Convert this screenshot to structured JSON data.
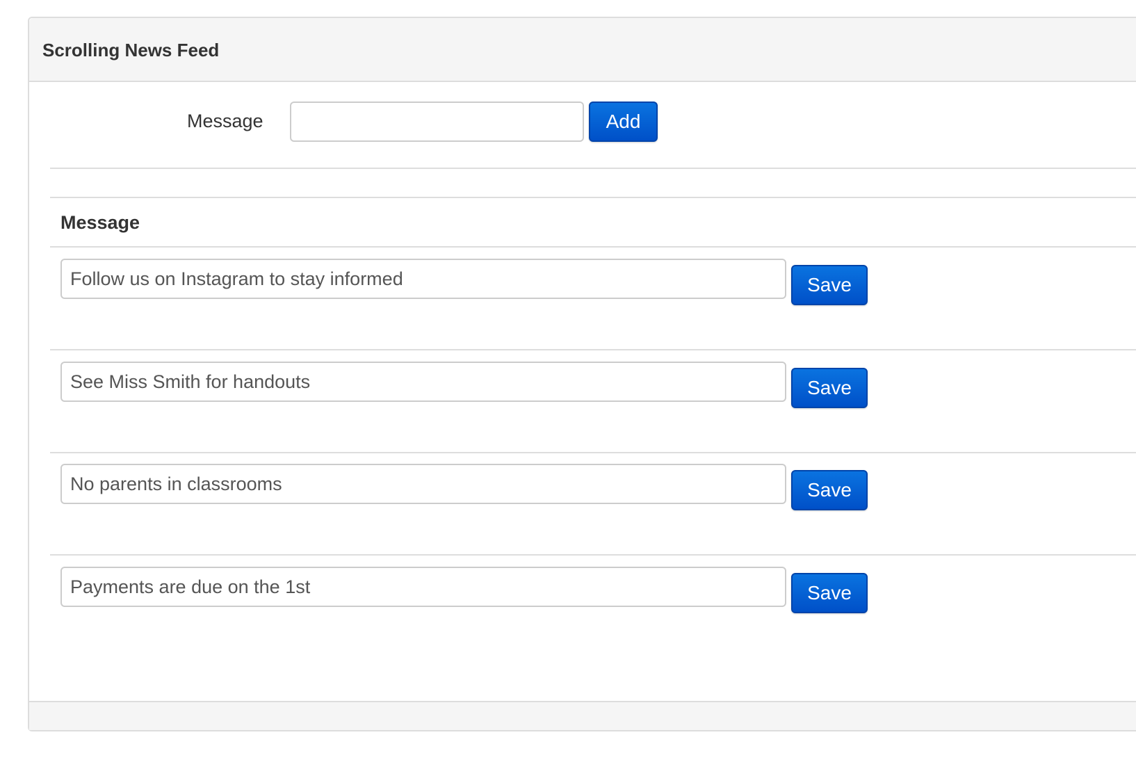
{
  "panel": {
    "title": "Scrolling News Feed"
  },
  "add_form": {
    "label": "Message",
    "input_value": "",
    "button_label": "Add"
  },
  "table": {
    "column_header": "Message",
    "rows": [
      {
        "message": "Follow us on Instagram to stay informed",
        "save_label": "Save"
      },
      {
        "message": "See Miss Smith for handouts",
        "save_label": "Save"
      },
      {
        "message": "No parents in classrooms",
        "save_label": "Save"
      },
      {
        "message": "Payments are due on the 1st",
        "save_label": "Save"
      }
    ]
  },
  "colors": {
    "primary_button": "#0a5fd6",
    "panel_heading_bg": "#f5f5f5",
    "border": "#dddddd"
  }
}
